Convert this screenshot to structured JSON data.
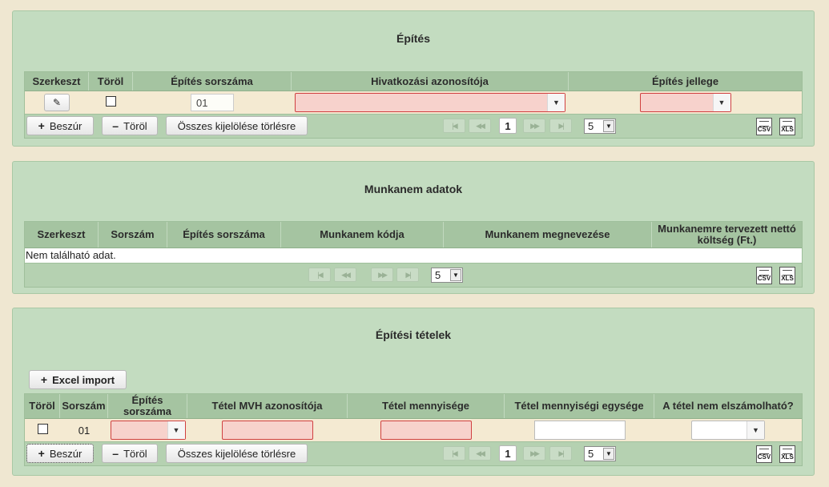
{
  "epites": {
    "title": "Építés",
    "columns": [
      "Szerkeszt",
      "Töröl",
      "Építés sorszáma",
      "Hivatkozási azonosítója",
      "Építés jellege"
    ],
    "row": {
      "sorszam": "01"
    },
    "buttons": {
      "insert": "Beszúr",
      "delete": "Töröl",
      "clear_all": "Összes kijelölése törlésre"
    },
    "pager": {
      "page": "1",
      "page_size": "5"
    },
    "export": {
      "csv": "CSV",
      "xls": "XLS"
    }
  },
  "munkanem": {
    "title": "Munkanem adatok",
    "columns": [
      "Szerkeszt",
      "Sorszám",
      "Építés sorszáma",
      "Munkanem kódja",
      "Munkanem megnevezése",
      "Munkanemre tervezett nettó költség (Ft.)"
    ],
    "empty_text": "Nem található adat.",
    "pager": {
      "page_size": "5"
    },
    "export": {
      "csv": "CSV",
      "xls": "XLS"
    }
  },
  "tetelek": {
    "title": "Építési tételek",
    "excel_import": "Excel import",
    "columns": [
      "Töröl",
      "Sorszám",
      "Építés sorszáma",
      "Tétel MVH azonosítója",
      "Tétel mennyisége",
      "Tétel mennyiségi egysége",
      "A tétel nem elszámolható?"
    ],
    "row": {
      "sorszam": "01"
    },
    "buttons": {
      "insert": "Beszúr",
      "delete": "Töröl",
      "clear_all": "Összes kijelölése törlésre"
    },
    "pager": {
      "page": "1",
      "page_size": "5"
    },
    "export": {
      "csv": "CSV",
      "xls": "XLS"
    }
  },
  "icons": {
    "plus": "+",
    "minus": "–",
    "dropdown": "▼",
    "edit": "✎",
    "first": "|◀",
    "prev": "◀◀",
    "next": "▶▶",
    "last": "▶|"
  },
  "colors": {
    "panel_bg": "#c3dcc0",
    "header_bg": "#a5c4a1",
    "row_bg": "#f4ead2",
    "invalid_bg": "#f7d2cc",
    "invalid_border": "#d04040"
  }
}
